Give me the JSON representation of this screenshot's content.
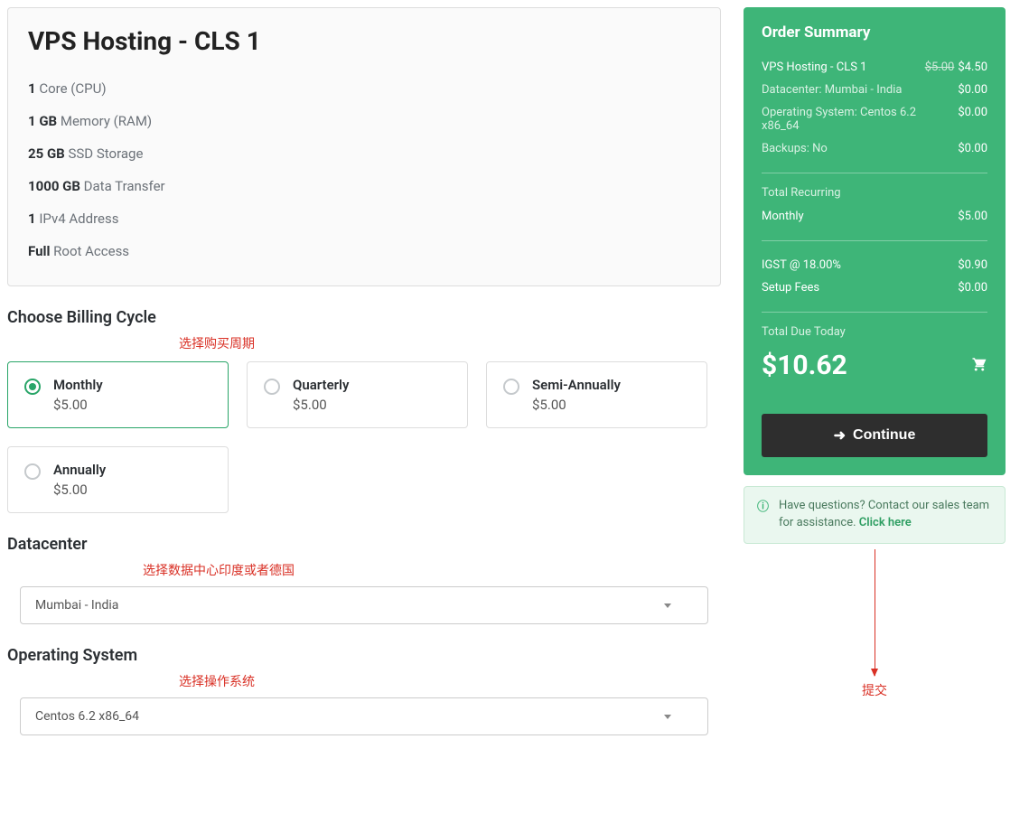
{
  "product": {
    "title": "VPS Hosting - CLS 1",
    "specs": [
      {
        "bold": "1",
        "rest": " Core (CPU)"
      },
      {
        "bold": "1 GB",
        "rest": " Memory (RAM)"
      },
      {
        "bold": "25 GB",
        "rest": " SSD Storage"
      },
      {
        "bold": "1000 GB",
        "rest": " Data Transfer"
      },
      {
        "bold": "1",
        "rest": " IPv4 Address"
      },
      {
        "bold": "Full",
        "rest": " Root Access"
      }
    ]
  },
  "billing": {
    "heading": "Choose Billing Cycle",
    "annotation": "选择购买周期",
    "options": [
      {
        "label": "Monthly",
        "price": "$5.00",
        "selected": true
      },
      {
        "label": "Quarterly",
        "price": "$5.00",
        "selected": false
      },
      {
        "label": "Semi-Annually",
        "price": "$5.00",
        "selected": false
      },
      {
        "label": "Annually",
        "price": "$5.00",
        "selected": false
      }
    ]
  },
  "datacenter": {
    "heading": "Datacenter",
    "annotation": "选择数据中心印度或者德国",
    "value": "Mumbai - India"
  },
  "os": {
    "heading": "Operating System",
    "annotation": "选择操作系统",
    "value": "Centos 6.2 x86_64"
  },
  "summary": {
    "title": "Order Summary",
    "items": [
      {
        "label": "VPS Hosting - CLS 1",
        "strike": "$5.00",
        "price": "$4.50"
      },
      {
        "label": "Datacenter: Mumbai - India",
        "price": "$0.00"
      },
      {
        "label": "Operating System: Centos 6.2 x86_64",
        "price": "$0.00"
      },
      {
        "label": "Backups: No",
        "price": "$0.00"
      }
    ],
    "recurring_label": "Total Recurring",
    "recurring": [
      {
        "label": "Monthly",
        "price": "$5.00"
      }
    ],
    "taxes": [
      {
        "label": "IGST @ 18.00%",
        "price": "$0.90"
      },
      {
        "label": "Setup Fees",
        "price": "$0.00"
      }
    ],
    "due_label": "Total Due Today",
    "due_amount": "$10.62",
    "continue_label": "Continue",
    "help_text": "Have questions? Contact our sales team for assistance. ",
    "help_link": "Click here",
    "submit_annotation": "提交"
  }
}
